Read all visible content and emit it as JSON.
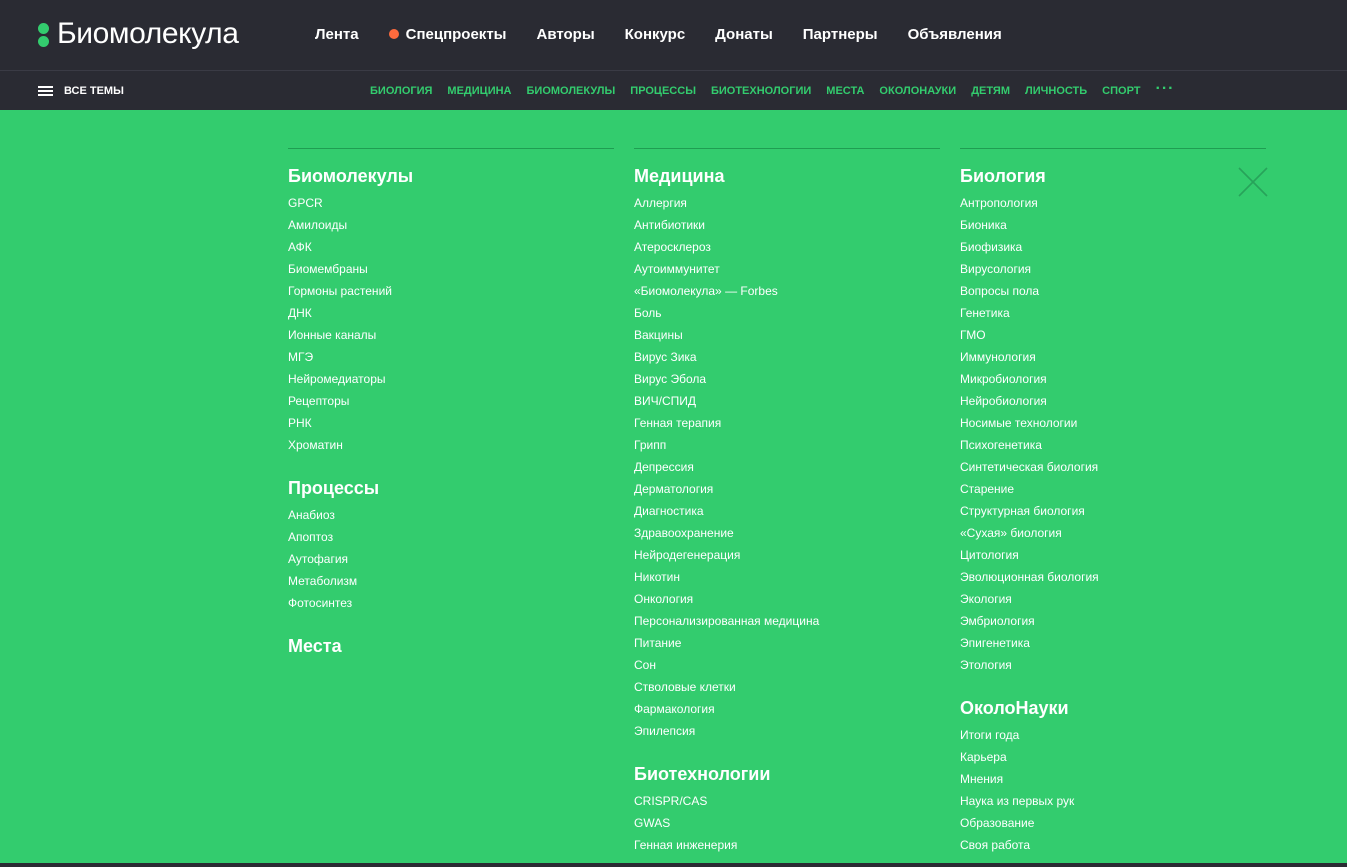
{
  "header": {
    "logo_text": "Биомолекула",
    "nav": [
      {
        "label": "Лента"
      },
      {
        "label": "Спецпроекты",
        "dot": true
      },
      {
        "label": "Авторы"
      },
      {
        "label": "Конкурс"
      },
      {
        "label": "Донаты"
      },
      {
        "label": "Партнеры"
      },
      {
        "label": "Объявления"
      }
    ]
  },
  "subnav": {
    "all_topics_label": "ВСЕ ТЕМЫ",
    "topics": [
      "БИОЛОГИЯ",
      "МЕДИЦИНА",
      "БИОМОЛЕКУЛЫ",
      "ПРОЦЕССЫ",
      "БИОТЕХНОЛОГИИ",
      "МЕСТА",
      "ОКОЛОНАУКИ",
      "ДЕТЯМ",
      "ЛИЧНОСТЬ",
      "СПОРТ"
    ],
    "more_label": "···"
  },
  "colors": {
    "background": "#33cc6e",
    "header": "#2a2b33",
    "accent": "#33cc6e",
    "dot": "#ff6b3d",
    "close": "#27a35a"
  },
  "icons": {
    "menu": "burger-icon",
    "more": "more-dots-icon",
    "close": "close-icon"
  },
  "menu": {
    "col1": [
      {
        "title": "Биомолекулы",
        "items": [
          "GPCR",
          "Амилоиды",
          "АФК",
          "Биомембраны",
          "Гормоны растений",
          "ДНК",
          "Ионные каналы",
          "МГЭ",
          "Нейромедиаторы",
          "Рецепторы",
          "РНК",
          "Хроматин"
        ]
      },
      {
        "title": "Процессы",
        "items": [
          "Анабиоз",
          "Апоптоз",
          "Аутофагия",
          "Метаболизм",
          "Фотосинтез"
        ]
      },
      {
        "title": "Места",
        "items": []
      }
    ],
    "col2": [
      {
        "title": "Медицина",
        "items": [
          "Аллергия",
          "Антибиотики",
          "Атеросклероз",
          "Аутоиммунитет",
          "«Биомолекула» — Forbes",
          "Боль",
          "Вакцины",
          "Вирус Зика",
          "Вирус Эбола",
          "ВИЧ/СПИД",
          "Генная терапия",
          "Грипп",
          "Депрессия",
          "Дерматология",
          "Диагностика",
          "Здравоохранение",
          "Нейродегенерация",
          "Никотин",
          "Онкология",
          "Персонализированная медицина",
          "Питание",
          "Сон",
          "Стволовые клетки",
          "Фармакология",
          "Эпилепсия"
        ]
      },
      {
        "title": "Биотехнологии",
        "items": [
          "CRISPR/CAS",
          "GWAS",
          "Генная инженерия"
        ]
      }
    ],
    "col3": [
      {
        "title": "Биология",
        "items": [
          "Антропология",
          "Бионика",
          "Биофизика",
          "Вирусология",
          "Вопросы пола",
          "Генетика",
          "ГМО",
          "Иммунология",
          "Микробиология",
          "Нейробиология",
          "Носимые технологии",
          "Психогенетика",
          "Синтетическая биология",
          "Старение",
          "Структурная биология",
          "«Сухая» биология",
          "Цитология",
          "Эволюционная биология",
          "Экология",
          "Эмбриология",
          "Эпигенетика",
          "Этология"
        ]
      },
      {
        "title": "ОколоНауки",
        "items": [
          "Итоги года",
          "Карьера",
          "Мнения",
          "Наука из первых рук",
          "Образование",
          "Своя работа"
        ]
      }
    ]
  }
}
